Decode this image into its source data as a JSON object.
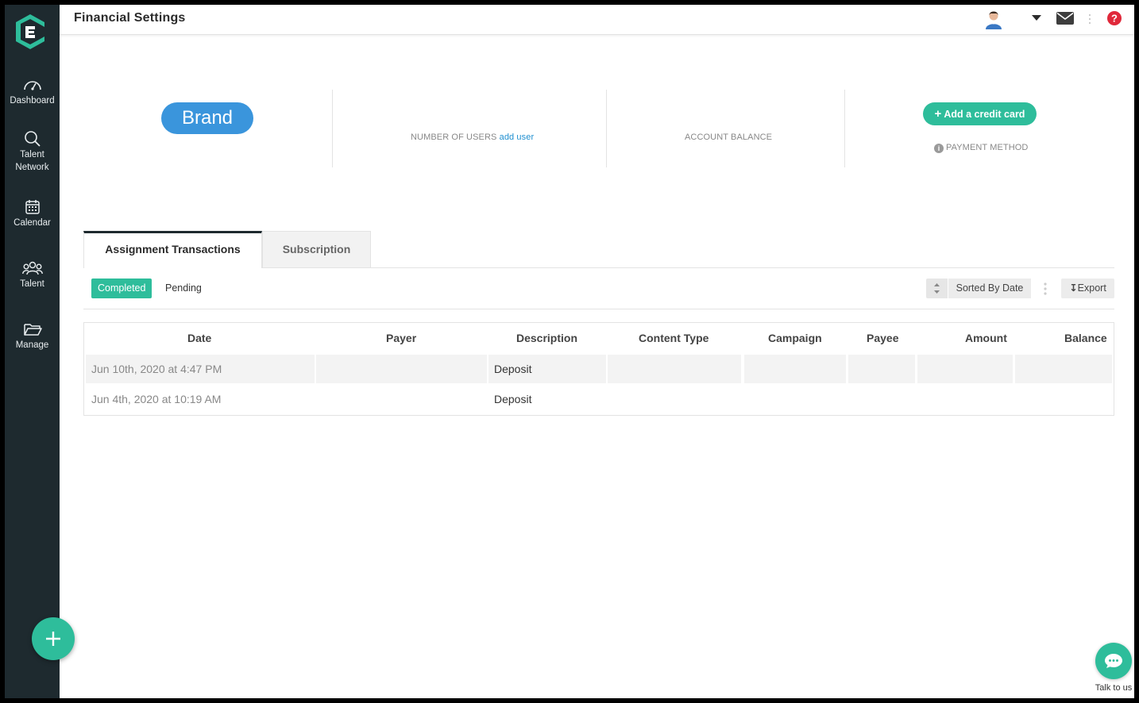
{
  "header": {
    "title": "Financial Settings"
  },
  "sidebar": {
    "items": [
      {
        "label": "Dashboard",
        "icon": "speedometer-icon"
      },
      {
        "label": "Talent Network",
        "icon": "search-icon"
      },
      {
        "label": "Calendar",
        "icon": "calendar-icon"
      },
      {
        "label": "Talent",
        "icon": "people-icon"
      },
      {
        "label": "Manage",
        "icon": "folder-icon"
      }
    ]
  },
  "stats": {
    "brand": "Brand",
    "users_label": "NUMBER OF USERS",
    "add_user": "add user",
    "balance_label": "ACCOUNT BALANCE",
    "add_card": "Add a credit card",
    "payment_label": "PAYMENT METHOD"
  },
  "tabs": [
    {
      "label": "Assignment Transactions",
      "active": true
    },
    {
      "label": "Subscription",
      "active": false
    }
  ],
  "filters": {
    "completed": "Completed",
    "pending": "Pending"
  },
  "toolbar": {
    "sort_label": "Sorted By Date",
    "export_label": "Export"
  },
  "table": {
    "columns": [
      "Date",
      "Payer",
      "Description",
      "Content Type",
      "Campaign",
      "Payee",
      "Amount",
      "Balance"
    ],
    "rows": [
      {
        "date": "Jun 10th, 2020 at 4:47 PM",
        "description": "Deposit"
      },
      {
        "date": "Jun 4th, 2020 at 10:19 AM",
        "description": "Deposit"
      }
    ]
  },
  "chat": {
    "label": "Talk to us"
  },
  "colors": {
    "sidebar": "#1e2a2f",
    "accent": "#2ebd9b",
    "brand": "#3a95dc",
    "link": "#1f8fd0",
    "help": "#e0283a"
  }
}
